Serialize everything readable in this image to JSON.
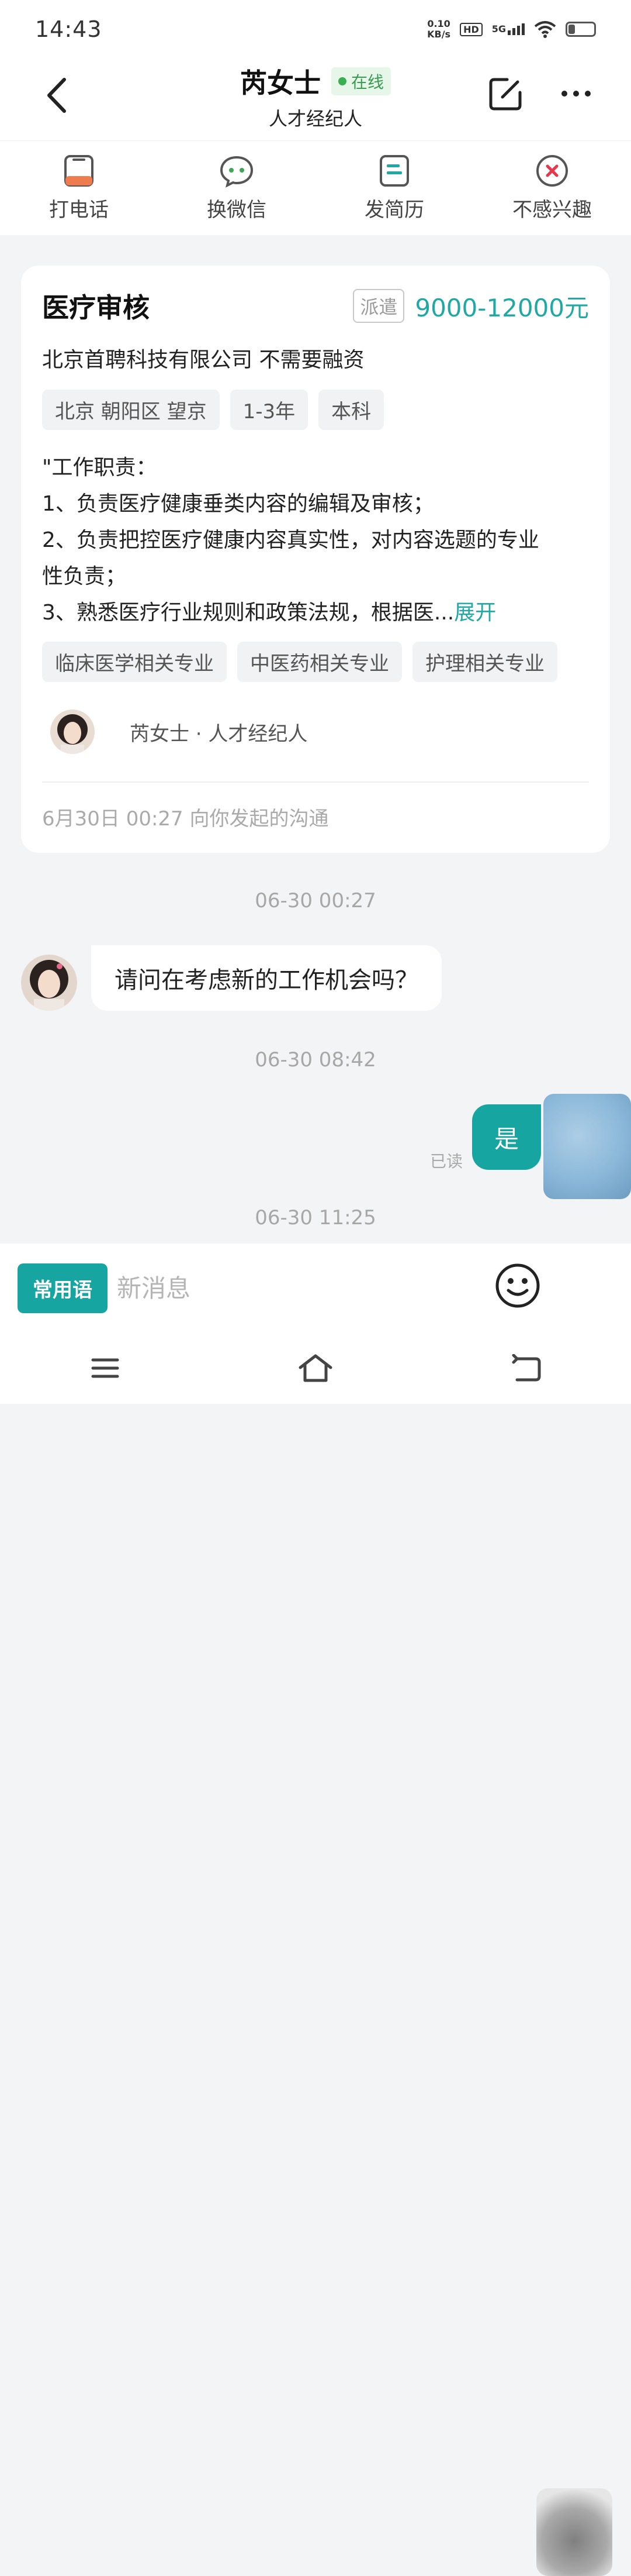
{
  "status_bar": {
    "time": "14:43",
    "net_speed_value": "0.10",
    "net_speed_unit": "KB/s",
    "hd_label": "HD",
    "network_label": "5G",
    "battery_level": 0.24
  },
  "header": {
    "name": "芮女士",
    "online_label": "在线",
    "subtitle": "人才经纪人",
    "icons": [
      "back-icon",
      "edit-icon",
      "more-icon"
    ]
  },
  "actions": [
    {
      "label": "打电话",
      "icon": "phone-icon",
      "color": "#ef7c4f"
    },
    {
      "label": "换微信",
      "icon": "wechat-icon",
      "color": "#3aa857"
    },
    {
      "label": "发简历",
      "icon": "resume-icon",
      "color": "#1fa8a4"
    },
    {
      "label": "不感兴趣",
      "icon": "not-interested-icon",
      "color": "#e8374b"
    }
  ],
  "job": {
    "title": "医疗审核",
    "dispatch_tag": "派遣",
    "salary": "9000-12000元",
    "company": "北京首聘科技有限公司 不需要融资",
    "tags": [
      "北京 朝阳区 望京",
      "1-3年",
      "本科"
    ],
    "desc_lines": [
      "\"工作职责：",
      "1、负责医疗健康垂类内容的编辑及审核；",
      "2、负责把控医疗健康内容真实性，对内容选题的专业",
      "性负责；",
      "3、熟悉医疗行业规则和政策法规，根据医..."
    ],
    "expand_label": "展开",
    "major_tags": [
      "临床医学相关专业",
      "中医药相关专业",
      "护理相关专业"
    ],
    "recruiter": "芮女士 · 人才经纪人",
    "initiated": "6月30日 00:27 向你发起的沟通"
  },
  "chat": {
    "timestamps": [
      "06-30 00:27",
      "06-30 08:42",
      "06-30 11:25"
    ],
    "incoming_message": "请问在考虑新的工作机会吗？",
    "outgoing_message": "是",
    "read_label": "已读"
  },
  "input_bar": {
    "common_phrases_label": "常用语",
    "placeholder": "新消息",
    "emoji_icon": "emoji-icon"
  },
  "nav_bar": {
    "icons": [
      "menu-icon",
      "home-icon",
      "back-nav-icon"
    ]
  },
  "colors": {
    "accent": "#17a5a2",
    "online": "#36b050"
  }
}
